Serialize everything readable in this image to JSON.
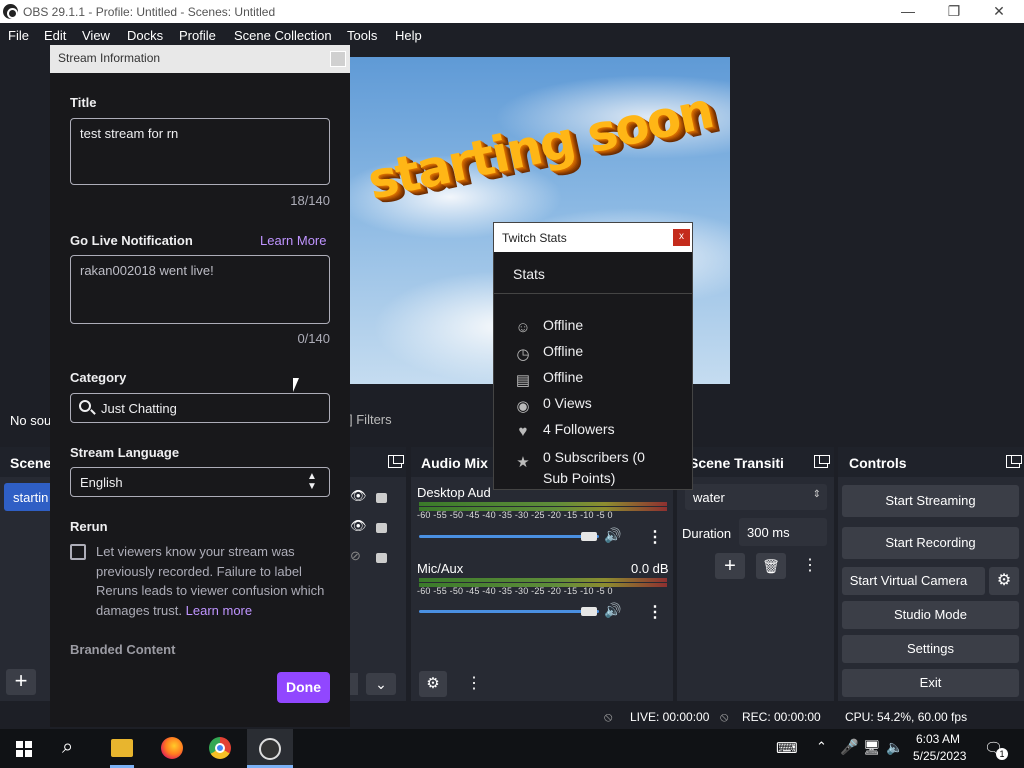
{
  "window": {
    "title": "OBS 29.1.1 - Profile: Untitled - Scenes: Untitled",
    "min": "—",
    "max": "❐",
    "close": "✕"
  },
  "menu": [
    "File",
    "Edit",
    "View",
    "Docks",
    "Profile",
    "Scene Collection",
    "Tools",
    "Help"
  ],
  "preview": {
    "overlay_text": "starting soon"
  },
  "sources_bar": {
    "no_source_text": "No sou",
    "filters_label": "Filters"
  },
  "scenes": {
    "title": "Scene",
    "selected": "startin"
  },
  "audio_mixer": {
    "title": "Audio Mix",
    "channels": [
      {
        "name": "Desktop Aud",
        "db": ""
      },
      {
        "name": "Mic/Aux",
        "db": "0.0 dB"
      }
    ],
    "scale": "-60 -55 -50 -45 -40 -35 -30 -25 -20 -15 -10 -5  0"
  },
  "transitions": {
    "title": "Scene Transiti",
    "selected": "water",
    "duration_label": "Duration",
    "duration_value": "300 ms"
  },
  "controls": {
    "title": "Controls",
    "start_streaming": "Start Streaming",
    "start_recording": "Start Recording",
    "start_virtual_camera": "Start Virtual Camera",
    "studio_mode": "Studio Mode",
    "settings": "Settings",
    "exit": "Exit"
  },
  "status": {
    "live": "LIVE: 00:00:00",
    "rec": "REC: 00:00:00",
    "cpu": "CPU: 54.2%, 60.00 fps"
  },
  "stream_info": {
    "header": "Stream Information",
    "title_label": "Title",
    "title_value": "test stream for rn",
    "title_count": "18/140",
    "notif_label": "Go Live Notification",
    "notif_learn": "Learn More",
    "notif_value": "rakan002018 went live!",
    "notif_count": "0/140",
    "category_label": "Category",
    "category_value": "Just Chatting",
    "language_label": "Stream Language",
    "language_value": "English",
    "rerun_label": "Rerun",
    "rerun_text": "Let viewers know your stream was previously recorded. Failure to label Reruns leads to viewer confusion which damages trust.",
    "rerun_learn": "Learn more",
    "branded_label": "Branded Content",
    "done": "Done"
  },
  "twitch_stats": {
    "header": "Twitch Stats",
    "close": "x",
    "stats_title": "Stats",
    "rows": [
      {
        "icon": "person-icon",
        "text": "Offline"
      },
      {
        "icon": "clock-icon",
        "text": "Offline"
      },
      {
        "icon": "clapper-icon",
        "text": "Offline"
      },
      {
        "icon": "eye-icon",
        "text": "0 Views"
      },
      {
        "icon": "heart-icon",
        "text": "4 Followers"
      },
      {
        "icon": "star-icon",
        "text": "0 Subscribers (0 Sub Points)"
      }
    ]
  },
  "taskbar": {
    "time": "6:03 AM",
    "date": "5/25/2023",
    "notif_count": "1"
  },
  "colors": {
    "accent_purple": "#9147ff",
    "link_purple": "#bf94ff",
    "obs_blue": "#3d79e1"
  }
}
